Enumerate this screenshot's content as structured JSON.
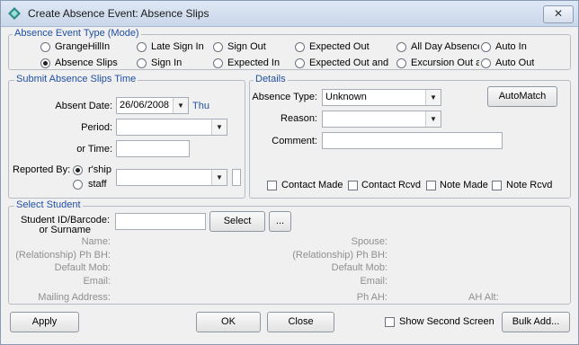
{
  "window": {
    "title": "Create Absence Event: Absence Slips",
    "close_glyph": "✕"
  },
  "event_type": {
    "legend": "Absence Event Type (Mode)",
    "options": [
      {
        "label": "GrangeHillIn",
        "selected": false
      },
      {
        "label": "Late Sign In",
        "selected": false
      },
      {
        "label": "Sign Out",
        "selected": false
      },
      {
        "label": "Expected Out",
        "selected": false
      },
      {
        "label": "All Day Absence",
        "selected": false
      },
      {
        "label": "Auto In",
        "selected": false
      },
      {
        "label": "Absence Slips",
        "selected": true
      },
      {
        "label": "Sign In",
        "selected": false
      },
      {
        "label": "Expected In",
        "selected": false
      },
      {
        "label": "Expected Out and",
        "selected": false
      },
      {
        "label": "Excursion Out a",
        "selected": false
      },
      {
        "label": "Auto Out",
        "selected": false
      }
    ]
  },
  "submit_time": {
    "legend": "Submit Absence Slips Time",
    "absent_date_label": "Absent Date:",
    "absent_date_value": "26/06/2008",
    "absent_day": "Thu",
    "period_label": "Period:",
    "period_value": "",
    "or_time_label": "or Time:",
    "or_time_value": "",
    "reported_by_label": "Reported By:",
    "reported_options": [
      {
        "label": "r'ship",
        "selected": true
      },
      {
        "label": "staff",
        "selected": false
      }
    ],
    "reported_value": ""
  },
  "details": {
    "legend": "Details",
    "absence_type_label": "Absence Type:",
    "absence_type_value": "Unknown",
    "reason_label": "Reason:",
    "reason_value": "",
    "comment_label": "Comment:",
    "comment_value": "",
    "automatch_label": "AutoMatch",
    "checkboxes": [
      {
        "label": "Contact Made",
        "checked": false
      },
      {
        "label": "Contact Rcvd",
        "checked": false
      },
      {
        "label": "Note Made",
        "checked": false
      },
      {
        "label": "Note Rcvd",
        "checked": false
      }
    ]
  },
  "select_student": {
    "legend": "Select Student",
    "id_label_1": "Student ID/Barcode:",
    "id_label_2": "or Surname",
    "id_value": "",
    "select_label": "Select",
    "ellipsis_label": "...",
    "left_fields": [
      "Name:",
      "(Relationship) Ph BH:",
      "Default Mob:",
      "Email:",
      "Mailing Address:"
    ],
    "right_fields": [
      "Spouse:",
      "(Relationship) Ph BH:",
      "Default Mob:",
      "Email:",
      "Ph AH:"
    ],
    "ah_alt_label": "AH Alt:"
  },
  "footer": {
    "apply_label": "Apply",
    "ok_label": "OK",
    "close_label": "Close",
    "show_second_label": "Show Second Screen",
    "show_second_checked": false,
    "bulk_add_label": "Bulk Add..."
  },
  "colors": {
    "legend_text": "#1f4fa3",
    "disabled_text": "#8f8f8f",
    "window_bg": "#f0f0f0"
  }
}
